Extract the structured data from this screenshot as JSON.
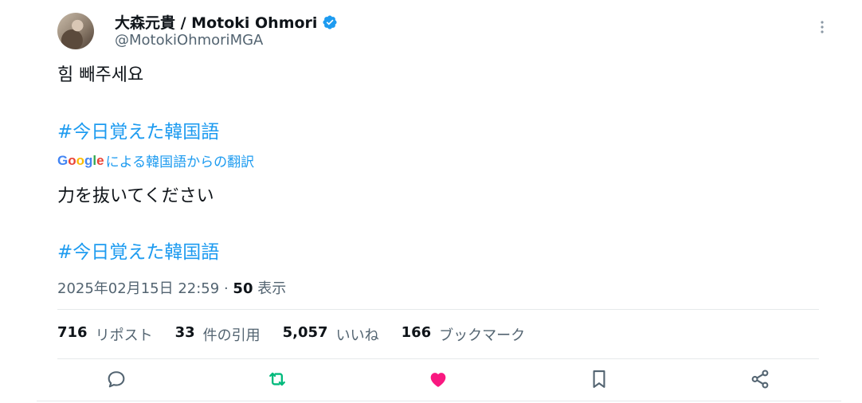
{
  "author": {
    "display_name": "大森元貴 / Motoki Ohmori",
    "handle": "@MotokiOhmoriMGA"
  },
  "tweet": {
    "text": "힘 빼주세요",
    "hashtag": "#今日覚えた韓国語",
    "translation_label": "による韓国語からの翻訳",
    "translation_provider": "Google",
    "translated_text": "力を抜いてください",
    "translated_hashtag": "#今日覚えた韓国語"
  },
  "meta": {
    "timestamp": "2025年02月15日 22:59",
    "separator": "·",
    "views": "50",
    "views_label": "表示"
  },
  "stats": [
    {
      "count": "716",
      "label": "リポスト"
    },
    {
      "count": "33",
      "label": "件の引用"
    },
    {
      "count": "5,057",
      "label": "いいね"
    },
    {
      "count": "166",
      "label": "ブックマーク"
    }
  ],
  "colors": {
    "accent": "#1d9bf0",
    "retweet": "#00ba7c",
    "like": "#f91880",
    "muted": "#536471"
  },
  "icons": [
    "reply-icon",
    "retweet-icon",
    "like-icon",
    "bookmark-icon",
    "share-icon",
    "more-icon",
    "verified-icon"
  ]
}
